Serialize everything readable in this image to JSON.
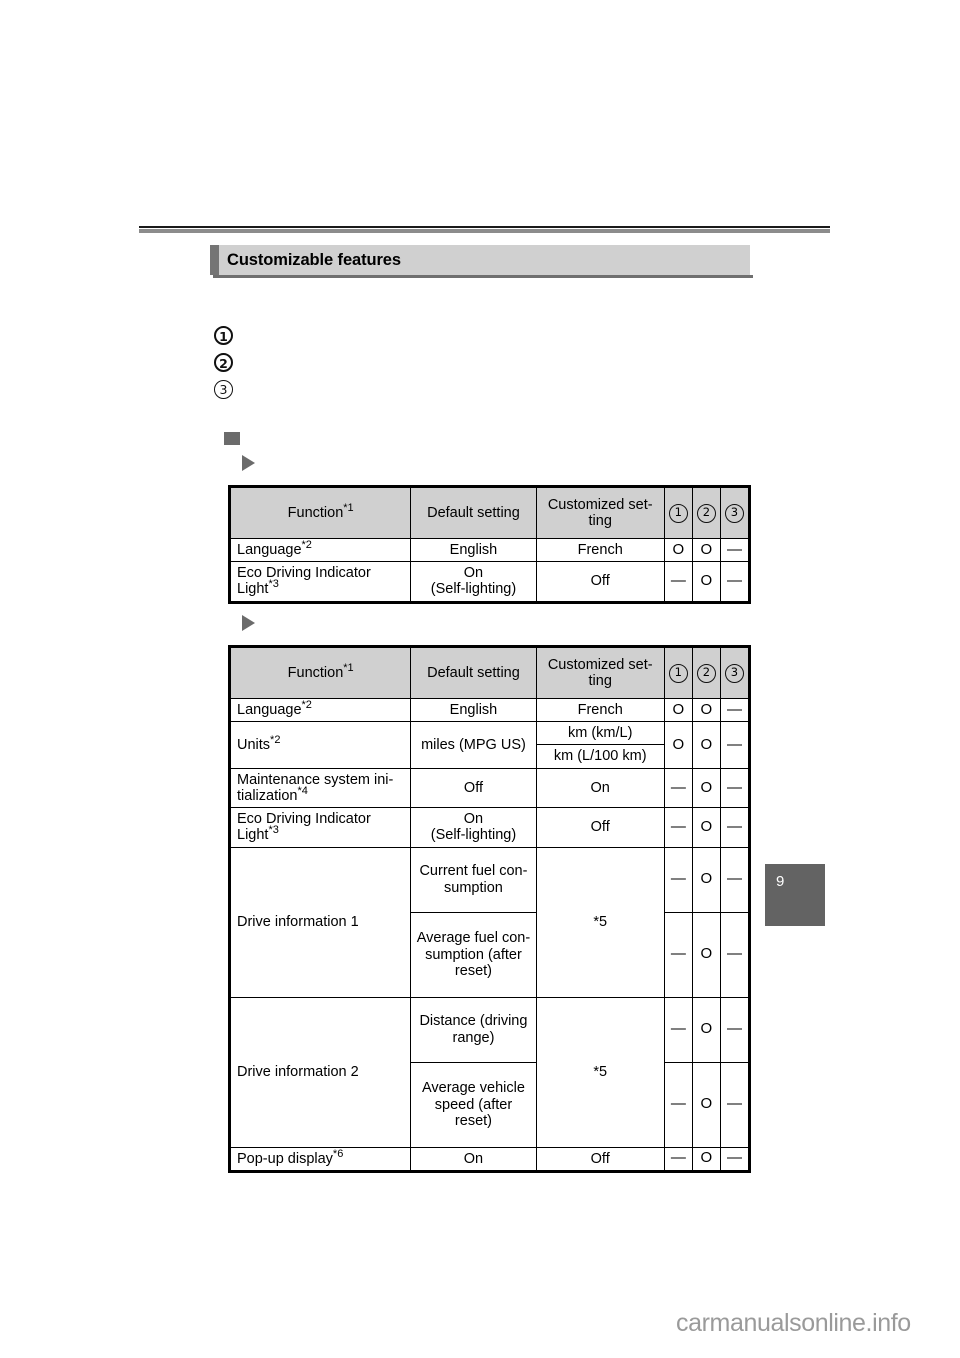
{
  "page": {
    "chapter_number": "9",
    "watermark": "carmanualsonline.info"
  },
  "section": {
    "title": "Customizable features"
  },
  "markers": [
    {
      "id": "1",
      "symbol": "1",
      "style": "bold"
    },
    {
      "id": "2",
      "symbol": "2",
      "style": "bold"
    },
    {
      "id": "3",
      "symbol": "3",
      "style": "plain"
    }
  ],
  "bullets": {
    "square": "■",
    "triangle": "▶"
  },
  "tables": [
    {
      "id": "table-1",
      "headers": {
        "function": "Function",
        "function_note": "*1",
        "default": "Default setting",
        "customized": "Customized set-ting",
        "col1": "1",
        "col2": "2",
        "col3": "3"
      },
      "rows": [
        {
          "function": "Language",
          "function_note": "*2",
          "justify": false,
          "default": "English",
          "customized": "French",
          "c1": "O",
          "c2": "O",
          "c3": "—"
        },
        {
          "function": "Eco Driving Indicator Light",
          "function_note": "*3",
          "justify": true,
          "default": "On\n(Self-lighting)",
          "customized": "Off",
          "c1": "—",
          "c2": "O",
          "c3": "—"
        }
      ]
    },
    {
      "id": "table-2",
      "headers": {
        "function": "Function",
        "function_note": "*1",
        "default": "Default setting",
        "customized": "Customized set-ting",
        "col1": "1",
        "col2": "2",
        "col3": "3"
      },
      "rows": [
        {
          "function": "Language",
          "function_note": "*2",
          "default": "English",
          "customized": "French",
          "c1": "O",
          "c2": "O",
          "c3": "—"
        },
        {
          "function": "Units",
          "function_note": "*2",
          "default": "miles (MPG US)",
          "customized_a": "km (km/L)",
          "customized_b": "km (L/100 km)",
          "c1": "O",
          "c2": "O",
          "c3": "—"
        },
        {
          "function": "Maintenance system ini-tialization",
          "function_note": "*4",
          "default": "Off",
          "customized": "On",
          "c1": "—",
          "c2": "O",
          "c3": "—"
        },
        {
          "function": "Eco Driving Indicator Light",
          "function_note": "*3",
          "default": "On\n(Self-lighting)",
          "customized": "Off",
          "c1": "—",
          "c2": "O",
          "c3": "—"
        },
        {
          "function": "Drive information 1",
          "function_note": "",
          "default_a": "Current fuel con-sumption",
          "default_b": "Average fuel con-sumption (after reset)",
          "customized": "*5",
          "a_c1": "—",
          "a_c2": "O",
          "a_c3": "—",
          "b_c1": "—",
          "b_c2": "O",
          "b_c3": "—"
        },
        {
          "function": "Drive information 2",
          "function_note": "",
          "default_a": "Distance (driving range)",
          "default_b": "Average vehicle speed (after reset)",
          "customized": "*5",
          "a_c1": "—",
          "a_c2": "O",
          "a_c3": "—",
          "b_c1": "—",
          "b_c2": "O",
          "b_c3": "—"
        },
        {
          "function": "Pop-up display",
          "function_note": "*6",
          "default": "On",
          "customized": "Off",
          "c1": "—",
          "c2": "O",
          "c3": "—"
        }
      ]
    }
  ]
}
